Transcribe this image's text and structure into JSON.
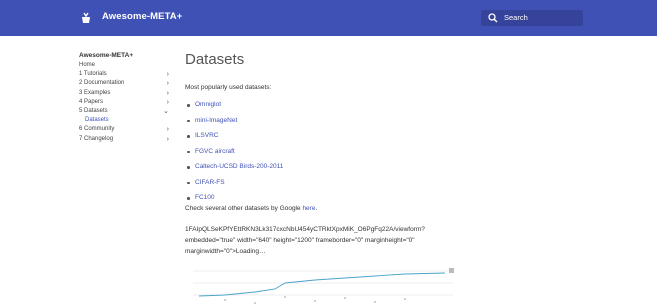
{
  "header": {
    "site_title": "Awesome-META+",
    "search_placeholder": "Search",
    "background": "#4051b5"
  },
  "nav": {
    "title": "Awesome-META+",
    "items": [
      {
        "label": "Home",
        "chevron": ""
      },
      {
        "label": "1 Tutorials",
        "chevron": "›"
      },
      {
        "label": "2 Documentation",
        "chevron": "›"
      },
      {
        "label": "3 Examples",
        "chevron": "›"
      },
      {
        "label": "4 Papers",
        "chevron": "›"
      },
      {
        "label": "5 Datasets",
        "chevron": "⌄"
      },
      {
        "label": "Datasets",
        "chevron": "",
        "active": true
      },
      {
        "label": "6 Community",
        "chevron": "›"
      },
      {
        "label": "7 Changelog",
        "chevron": "›"
      }
    ]
  },
  "main": {
    "title": "Datasets",
    "intro": "Most popularly used datasets:",
    "datasets": [
      "Omniglot",
      "mini-ImageNet",
      "ILSVRC",
      "FGVC aircraft",
      "Caltech-UCSD Birds-200-2011",
      "CIFAR-FS",
      "FC100"
    ],
    "check_prefix": "Check several other datasets by Google ",
    "check_link": "here",
    "check_suffix": ".",
    "embed_text": "1FAIpQLSeKPfYEttRKN3Lk317cxcNbU454yCTRktXpxMiK_O6PgFq22A/viewform? embedded=\"true\" width=\"640\" height=\"1200\" frameborder=\"0\" marginheight=\"0\" marginwidth=\"0\">Loading…"
  }
}
